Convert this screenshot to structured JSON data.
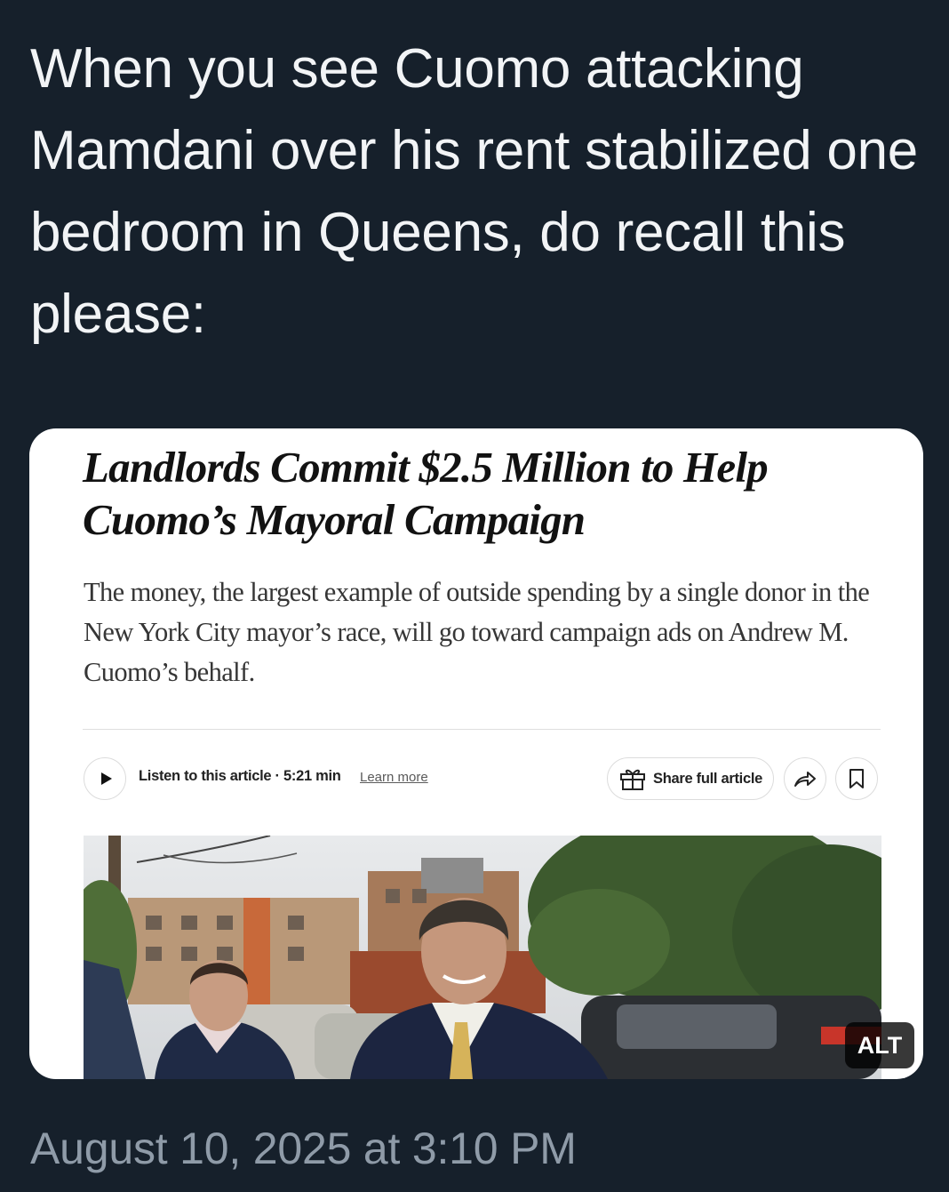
{
  "tweet": {
    "text": "When you see Cuomo attacking Mamdani over his rent stabilized one bedroom in Queens, do recall this please:",
    "timestamp": "August 10, 2025 at 3:10 PM"
  },
  "article": {
    "headline": "Landlords Commit $2.5 Million to Help Cuomo’s Mayoral Campaign",
    "summary": "The money, the largest example of outside spending by a single donor in the New York City mayor’s race, will go toward campaign ads on Andrew M. Cuomo’s behalf.",
    "listen_label": "Listen to this article · 5:21 min",
    "learn_more": "Learn more",
    "share_label": "Share full article",
    "icons": {
      "play": "play-icon",
      "gift": "gift-icon",
      "share": "share-arrow-icon",
      "bookmark": "bookmark-icon"
    }
  },
  "media": {
    "alt_badge": "ALT"
  },
  "colors": {
    "background": "#16202b",
    "tweet_text": "#f2f4f6",
    "timestamp": "#8f9ba8",
    "card": "#ffffff"
  }
}
